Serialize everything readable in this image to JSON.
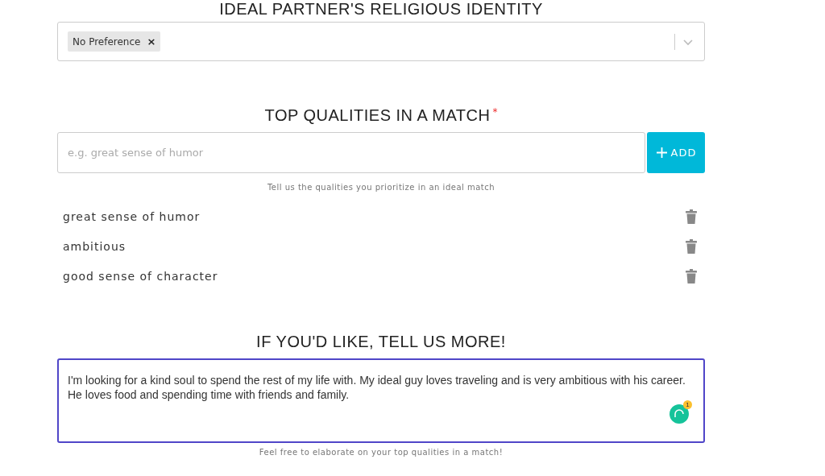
{
  "religion": {
    "heading": "IDEAL PARTNER'S RELIGIOUS IDENTITY",
    "tags": [
      {
        "label": "No Preference",
        "remove": "×"
      }
    ]
  },
  "qualities": {
    "heading": "TOP QUALITIES IN A MATCH",
    "required": "*",
    "placeholder": "e.g. great sense of humor",
    "add_button": "ADD",
    "hint": "Tell us the qualities you prioritize in an ideal match",
    "items": [
      {
        "label": "great sense of humor"
      },
      {
        "label": "ambitious"
      },
      {
        "label": "good sense of character"
      }
    ]
  },
  "more": {
    "heading": "IF YOU'D LIKE, TELL US MORE!",
    "value": "I'm looking for a kind soul to spend the rest of my life with. My ideal guy loves traveling and is very ambitious with his career. He loves food and spending time with friends and family.",
    "badge_count": "1",
    "hint": "Feel free to elaborate on your top qualities in a match!"
  }
}
